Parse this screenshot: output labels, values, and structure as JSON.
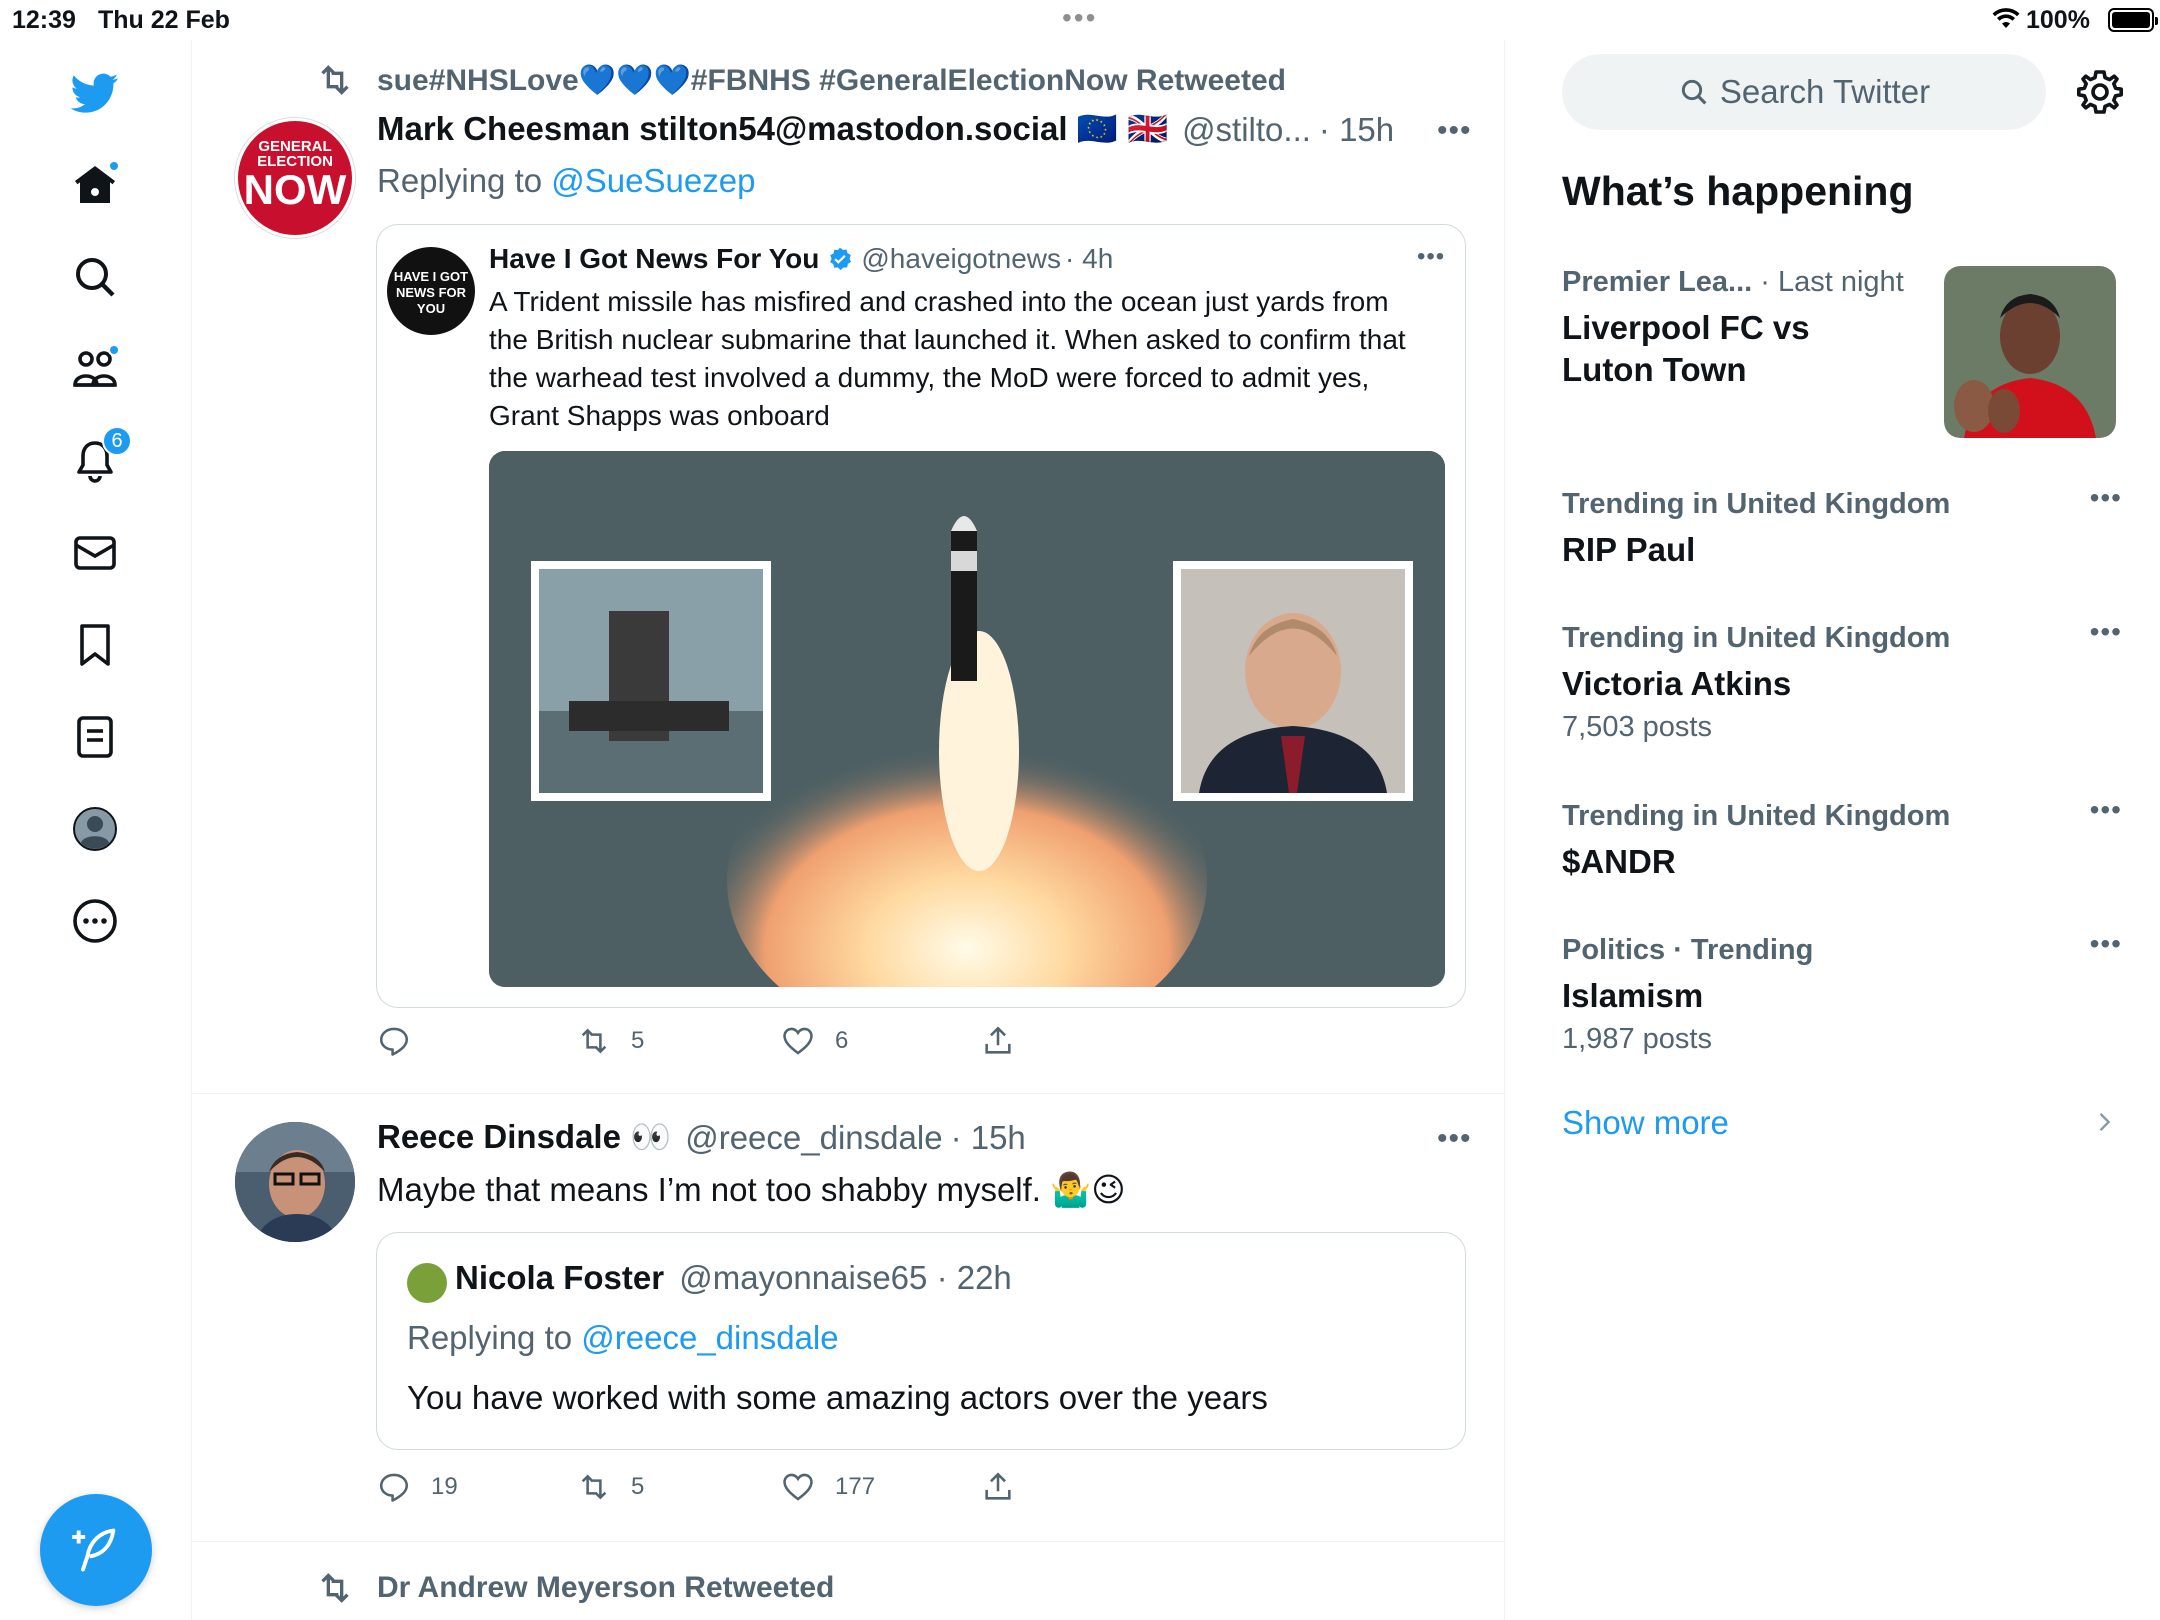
{
  "status_bar": {
    "time": "12:39",
    "date": "Thu 22 Feb",
    "battery": "100%"
  },
  "nav": {
    "notifications_badge": "6"
  },
  "tweets": [
    {
      "retweeted_by": "sue#NHSLove💙💙💙#FBNHS #GeneralElectionNow Retweeted",
      "name": "Mark Cheesman stilton54@mastodon.social 🇪🇺 🇬🇧",
      "handle": "@stilto...",
      "time": "· 15h",
      "replying_to_label": "Replying to",
      "replying_to": "@SueSuezep",
      "avatar_text": {
        "line1": "GENERAL",
        "line2": "ELECTION",
        "line3": "NOW"
      },
      "quote": {
        "name": "Have I Got News For You",
        "handle": "@haveigotnews",
        "time": "· 4h",
        "avatar_text": "HAVE I GOT NEWS FOR YOU",
        "text_lines": [
          "A Trident missile has misfired and crashed into the ocean just yards from",
          "the British nuclear submarine that launched it.  When asked to confirm that",
          "the warhead test involved a dummy, the MoD were forced to admit yes,",
          "Grant Shapps was onboard"
        ]
      },
      "actions": {
        "replies": "",
        "retweets": "5",
        "likes": "6"
      }
    },
    {
      "name": "Reece Dinsdale 👀",
      "handle": "@reece_dinsdale",
      "time": "· 15h",
      "text": "Maybe that means I’m not too shabby myself. 🤷‍♂️😉",
      "quote": {
        "name": "Nicola Foster",
        "handle": "@mayonnaise65",
        "time": "· 22h",
        "replying_to_label": "Replying to",
        "replying_to": "@reece_dinsdale",
        "text": "You have worked with some amazing actors over the years"
      },
      "actions": {
        "replies": "19",
        "retweets": "5",
        "likes": "177"
      }
    },
    {
      "retweeted_by": "Dr Andrew Meyerson Retweeted"
    }
  ],
  "right": {
    "search_placeholder": "Search Twitter",
    "section_title": "What’s happening",
    "trends": [
      {
        "meta": "Premier Lea...",
        "meta2": " · Last night",
        "title": "Liverpool FC vs Luton Town",
        "count": ""
      },
      {
        "meta": "Trending in United Kingdom",
        "title": "RIP Paul",
        "count": ""
      },
      {
        "meta": "Trending in United Kingdom",
        "title": "Victoria Atkins",
        "count": "7,503 posts"
      },
      {
        "meta": "Trending in United Kingdom",
        "title": "$ANDR",
        "count": ""
      },
      {
        "meta": "Politics · Trending",
        "title": "Islamism",
        "count": "1,987 posts"
      }
    ],
    "show_more": "Show more"
  },
  "colors": {
    "accent": "#1d9bf0",
    "text": "#0f1419",
    "secondary": "#536471"
  }
}
